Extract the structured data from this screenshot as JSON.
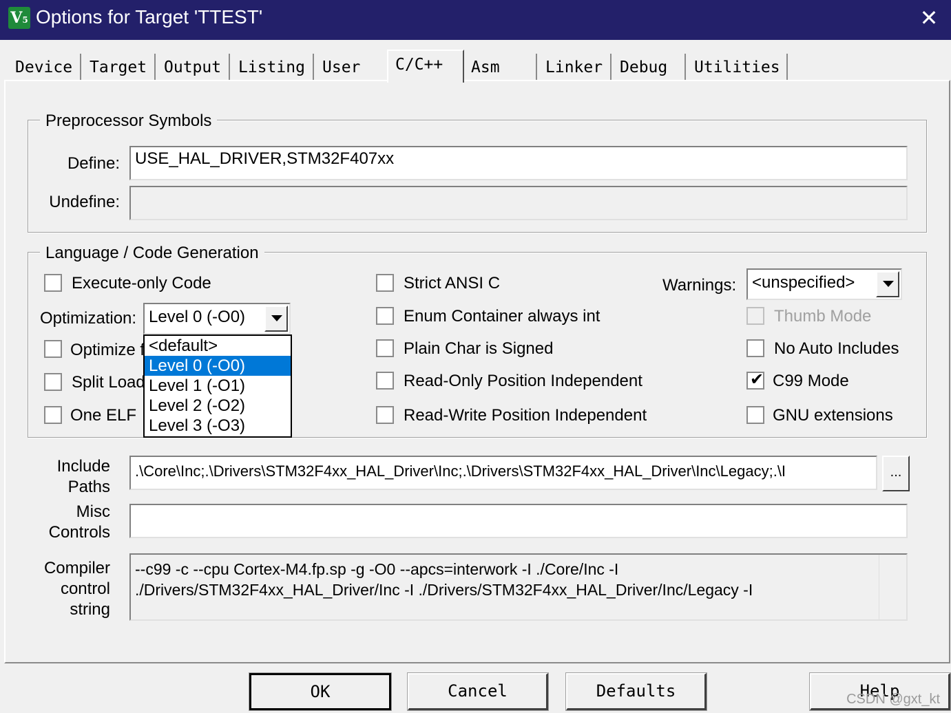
{
  "window": {
    "title": "Options for Target 'TTEST'",
    "icon": "keil-uvision-icon",
    "close_label": "✕"
  },
  "tabs": [
    "Device",
    "Target",
    "Output",
    "Listing",
    "User",
    "C/C++",
    "Asm",
    "Linker",
    "Debug",
    "Utilities"
  ],
  "active_tab": "C/C++",
  "preprocessor": {
    "group_label": "Preprocessor Symbols",
    "define_label": "Define:",
    "define_value": "USE_HAL_DRIVER,STM32F407xx",
    "undefine_label": "Undefine:",
    "undefine_value": ""
  },
  "language": {
    "group_label": "Language / Code Generation",
    "execute_only": {
      "label": "Execute-only Code",
      "checked": false
    },
    "optimization_label": "Optimization:",
    "optimization_value": "Level 0 (-O0)",
    "optimization_options": [
      "<default>",
      "Level 0 (-O0)",
      "Level 1 (-O1)",
      "Level 2 (-O2)",
      "Level 3 (-O3)"
    ],
    "optimization_selected_index": 1,
    "optimize_for_time": {
      "label": "Optimize f",
      "checked": false
    },
    "split_load": {
      "label": "Split Load",
      "checked": false
    },
    "one_elf": {
      "label": "One ELF",
      "checked": false
    },
    "strict_ansi": {
      "label": "Strict ANSI C",
      "checked": false
    },
    "enum_container": {
      "label": "Enum Container always int",
      "checked": false
    },
    "plain_char": {
      "label": "Plain Char is Signed",
      "checked": false
    },
    "ro_pi": {
      "label": "Read-Only Position Independent",
      "checked": false
    },
    "rw_pi": {
      "label": "Read-Write Position Independent",
      "checked": false
    },
    "warnings_label": "Warnings:",
    "warnings_value": "<unspecified>",
    "thumb_mode": {
      "label": "Thumb Mode",
      "checked": false,
      "disabled": true
    },
    "no_auto_includes": {
      "label": "No Auto Includes",
      "checked": false
    },
    "c99_mode": {
      "label": "C99 Mode",
      "checked": true
    },
    "gnu_extensions": {
      "label": "GNU extensions",
      "checked": false
    }
  },
  "paths": {
    "include_label_1": "Include",
    "include_label_2": "Paths",
    "include_value": ".\\Core\\Inc;.\\Drivers\\STM32F4xx_HAL_Driver\\Inc;.\\Drivers\\STM32F4xx_HAL_Driver\\Inc\\Legacy;.\\I",
    "browse_label": "...",
    "misc_label_1": "Misc",
    "misc_label_2": "Controls",
    "misc_value": "",
    "compiler_label_1": "Compiler",
    "compiler_label_2": "control",
    "compiler_label_3": "string",
    "compiler_line_1": "--c99 -c --cpu Cortex-M4.fp.sp -g -O0 --apcs=interwork -I ./Core/Inc -I",
    "compiler_line_2": "./Drivers/STM32F4xx_HAL_Driver/Inc -I ./Drivers/STM32F4xx_HAL_Driver/Inc/Legacy -I"
  },
  "buttons": {
    "ok": "OK",
    "cancel": "Cancel",
    "defaults": "Defaults",
    "help": "Help"
  },
  "watermark": "CSDN @gxt_kt",
  "colors": {
    "titlebar": "#23206a",
    "selection": "#0078d7",
    "background": "#f0f0f0"
  }
}
